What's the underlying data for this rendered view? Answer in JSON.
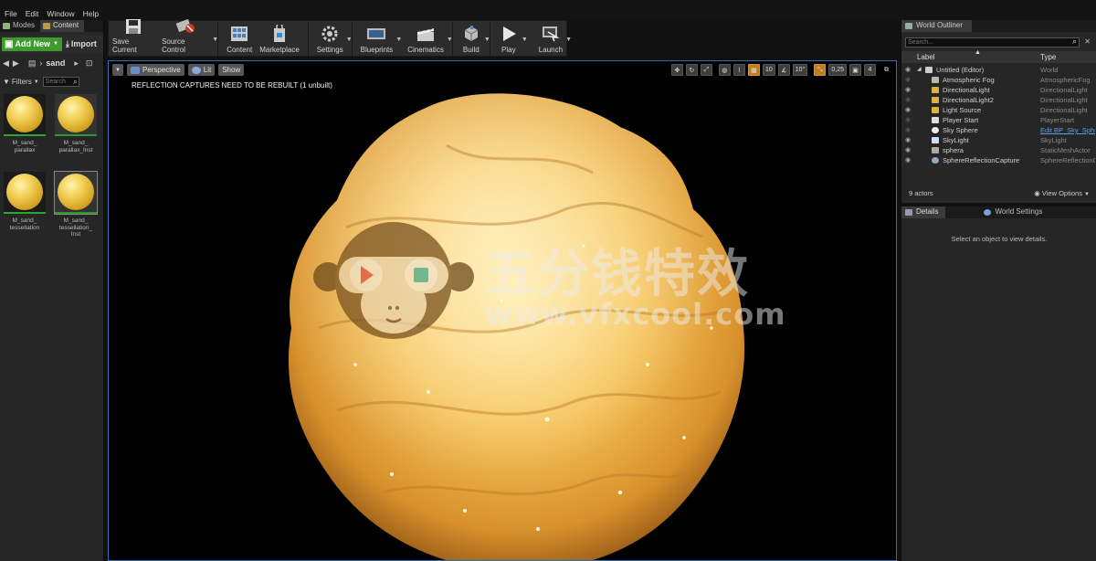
{
  "menu": [
    "File",
    "Edit",
    "Window",
    "Help"
  ],
  "left_tabs": [
    "Modes",
    "Content"
  ],
  "content_browser": {
    "add_new_label": "Add New",
    "import_label": "Import",
    "breadcrumb": "sand",
    "filters_label": "Filters",
    "search_placeholder": "Search",
    "assets": [
      {
        "name": "M_sand_\nparallax"
      },
      {
        "name": "M_sand_\nparallax_Inst"
      },
      {
        "name": "M_sand_\ntessellation"
      },
      {
        "name": "M_sand_\ntessellation_\nInst"
      }
    ]
  },
  "toolbar": [
    {
      "label": "Save Current",
      "icon": "save-icon"
    },
    {
      "label": "Source Control",
      "icon": "source-control-icon"
    },
    {
      "label": "Content",
      "icon": "content-icon"
    },
    {
      "label": "Marketplace",
      "icon": "marketplace-icon"
    },
    {
      "label": "Settings",
      "icon": "settings-icon"
    },
    {
      "label": "Blueprints",
      "icon": "blueprints-icon"
    },
    {
      "label": "Cinematics",
      "icon": "cinematics-icon"
    },
    {
      "label": "Build",
      "icon": "build-icon"
    },
    {
      "label": "Play",
      "icon": "play-icon"
    },
    {
      "label": "Launch",
      "icon": "launch-icon"
    }
  ],
  "viewport": {
    "perspective_label": "Perspective",
    "lit_label": "Lit",
    "show_label": "Show",
    "warning": "REFLECTION CAPTURES NEED TO BE REBUILT (1 unbuilt)",
    "grid_snap": "10",
    "rotation_snap": "10°",
    "scale_snap": "0,25",
    "camera_speed": "4"
  },
  "watermark": {
    "chinese": "五分钱特效",
    "url": "www.vfxcool.com"
  },
  "outliner": {
    "tab": "World Outliner",
    "search_placeholder": "Search...",
    "col_label": "Label",
    "col_type": "Type",
    "rows": [
      {
        "label": "Untitled (Editor)",
        "type": "World"
      },
      {
        "label": "Atmospheric Fog",
        "type": "AtmosphericFog"
      },
      {
        "label": "DirectionalLight",
        "type": "DirectionalLight"
      },
      {
        "label": "DirectionalLight2",
        "type": "DirectionalLight"
      },
      {
        "label": "Light Source",
        "type": "DirectionalLight"
      },
      {
        "label": "Player Start",
        "type": "PlayerStart"
      },
      {
        "label": "Sky Sphere",
        "type": "Edit BP_Sky_Sphere"
      },
      {
        "label": "SkyLight",
        "type": "SkyLight"
      },
      {
        "label": "sphera",
        "type": "StaticMeshActor"
      },
      {
        "label": "SphereReflectionCapture",
        "type": "SphereReflectionCapture"
      }
    ],
    "count": "9 actors",
    "view_options": "View Options"
  },
  "details": {
    "tabs": [
      "Details",
      "World Settings"
    ],
    "hint": "Select an object to view details."
  }
}
